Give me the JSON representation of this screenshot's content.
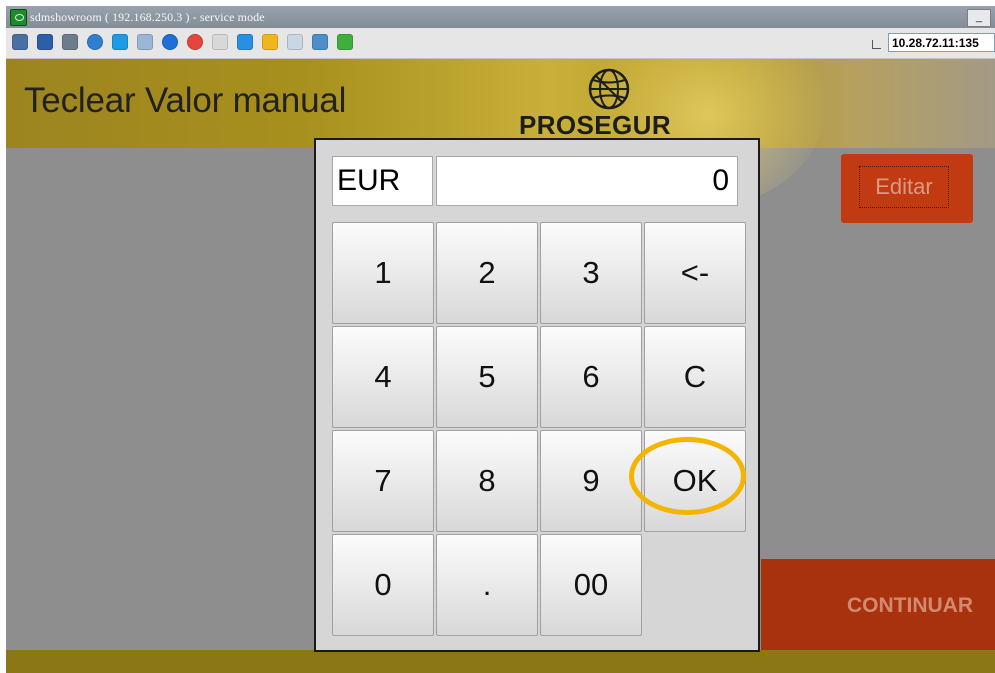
{
  "window": {
    "title": "sdmshowroom ( 192.168.250.3 ) - service mode",
    "minimize_label": "_",
    "address": "10.28.72.11:135"
  },
  "toolbar": {
    "icons": [
      {
        "name": "settings-gear-icon",
        "color": "#4a6fa5"
      },
      {
        "name": "fullscreen-icon",
        "color": "#2d5fa8"
      },
      {
        "name": "options-icon",
        "color": "#6d7c8c"
      },
      {
        "name": "refresh-icon",
        "color": "#2f7fd0"
      },
      {
        "name": "windows-icon",
        "color": "#1f9be6"
      },
      {
        "name": "window-icon",
        "color": "#9bb6d6"
      },
      {
        "name": "info-icon",
        "color": "#1e6fd9"
      },
      {
        "name": "stop-icon",
        "color": "#e2463f"
      },
      {
        "name": "disconnect-icon",
        "color": "#d8d8d8"
      },
      {
        "name": "monitor-icon",
        "color": "#2a8fe0"
      },
      {
        "name": "folder-icon",
        "color": "#f2b61c"
      },
      {
        "name": "clipboard-icon",
        "color": "#c9d6e3"
      },
      {
        "name": "computer-icon",
        "color": "#4f8dc9"
      },
      {
        "name": "chat-icon",
        "color": "#3fae3c"
      }
    ]
  },
  "screen": {
    "title": "Teclear Valor manual",
    "logo_text": "PROSEGUR",
    "edit_label": "Editar",
    "continue_label": "CONTINUAR"
  },
  "keypad": {
    "currency": "EUR",
    "amount": "0",
    "keys": [
      "1",
      "2",
      "3",
      "<-",
      "4",
      "5",
      "6",
      "C",
      "7",
      "8",
      "9",
      "OK",
      "0",
      ".",
      "00"
    ]
  },
  "colors": {
    "header_band": "#a8901e",
    "edit_button": "#c13a12",
    "continue_bar": "#a9320e",
    "ok_highlight": "#f4b400"
  }
}
